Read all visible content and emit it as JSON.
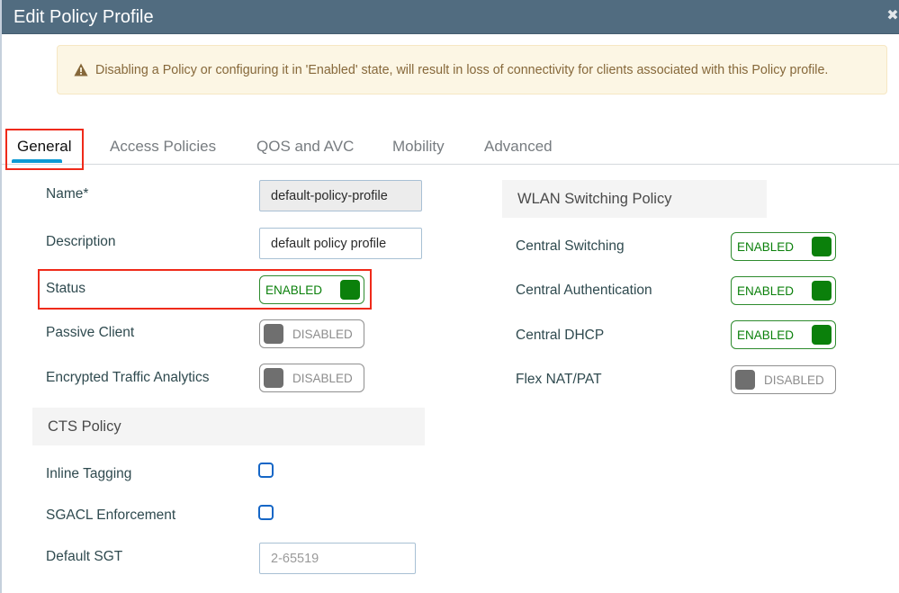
{
  "modal": {
    "title": "Edit Policy Profile",
    "close_icon": "close-icon"
  },
  "alert": {
    "icon": "warning-triangle-icon",
    "text": "Disabling a Policy or configuring it in 'Enabled' state, will result in loss of connectivity for clients associated with this Policy profile."
  },
  "tabs": [
    {
      "label": "General",
      "active": true
    },
    {
      "label": "Access Policies",
      "active": false
    },
    {
      "label": "QOS and AVC",
      "active": false
    },
    {
      "label": "Mobility",
      "active": false
    },
    {
      "label": "Advanced",
      "active": false
    }
  ],
  "general": {
    "name": {
      "label": "Name*",
      "value": "default-policy-profile"
    },
    "description": {
      "label": "Description",
      "value": "default policy profile"
    },
    "status": {
      "label": "Status",
      "state": "ENABLED"
    },
    "passive_client": {
      "label": "Passive Client",
      "state": "DISABLED"
    },
    "encrypted_traffic_analytics": {
      "label": "Encrypted Traffic Analytics",
      "state": "DISABLED"
    }
  },
  "cts_policy": {
    "title": "CTS Policy",
    "inline_tagging": {
      "label": "Inline Tagging",
      "checked": false
    },
    "sgacl_enforcement": {
      "label": "SGACL Enforcement",
      "checked": false
    },
    "default_sgt": {
      "label": "Default SGT",
      "value": "",
      "placeholder": "2-65519"
    }
  },
  "wlan_switching_policy": {
    "title": "WLAN Switching Policy",
    "central_switching": {
      "label": "Central Switching",
      "state": "ENABLED"
    },
    "central_authentication": {
      "label": "Central Authentication",
      "state": "ENABLED"
    },
    "central_dhcp": {
      "label": "Central DHCP",
      "state": "ENABLED"
    },
    "flex_nat_pat": {
      "label": "Flex NAT/PAT",
      "state": "DISABLED"
    }
  },
  "colors": {
    "header_bg": "#516c80",
    "tab_accent": "#0d9ad4",
    "enabled_green": "#0b800b",
    "disabled_gray": "#6f6f6f",
    "alert_bg": "#fcf6e4",
    "alert_text": "#86683a",
    "highlight_red": "#ef2a1a",
    "checkbox_blue": "#1566c6"
  }
}
